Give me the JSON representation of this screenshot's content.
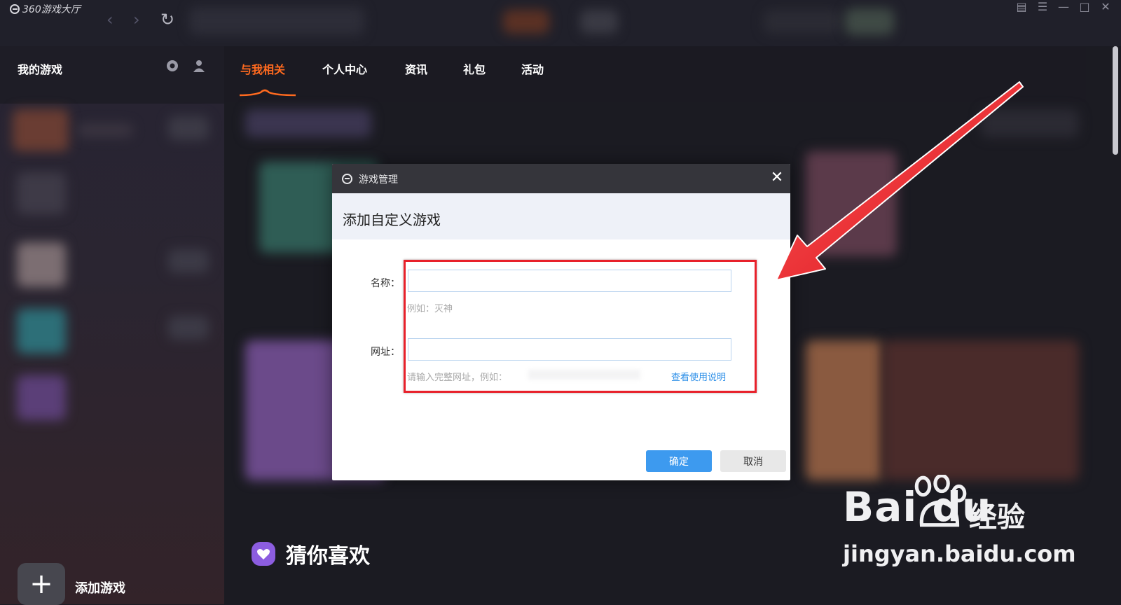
{
  "app": {
    "brand": "360游戏大厅"
  },
  "sidebar": {
    "title": "我的游戏",
    "add_game_label": "添加游戏"
  },
  "tabs": [
    {
      "label": "与我相关",
      "active": true
    },
    {
      "label": "个人中心",
      "active": false
    },
    {
      "label": "资讯",
      "active": false
    },
    {
      "label": "礼包",
      "active": false
    },
    {
      "label": "活动",
      "active": false
    }
  ],
  "section": {
    "guess_title": "猜你喜欢"
  },
  "dialog": {
    "title": "游戏管理",
    "heading": "添加自定义游戏",
    "name_label": "名称：",
    "name_value": "",
    "name_hint": "例如：灭神",
    "url_label": "网址：",
    "url_value": "",
    "url_hint": "请输入完整网址，例如：",
    "help_link": "查看使用说明",
    "ok_label": "确定",
    "cancel_label": "取消"
  },
  "watermark": {
    "main": "Bai du",
    "suffix": "经验",
    "url": "jingyan.baidu.com"
  },
  "colors": {
    "accent": "#ff6a1f",
    "annotation": "#e8212b",
    "primary_button": "#3d9aef",
    "link": "#2d8fe8"
  }
}
